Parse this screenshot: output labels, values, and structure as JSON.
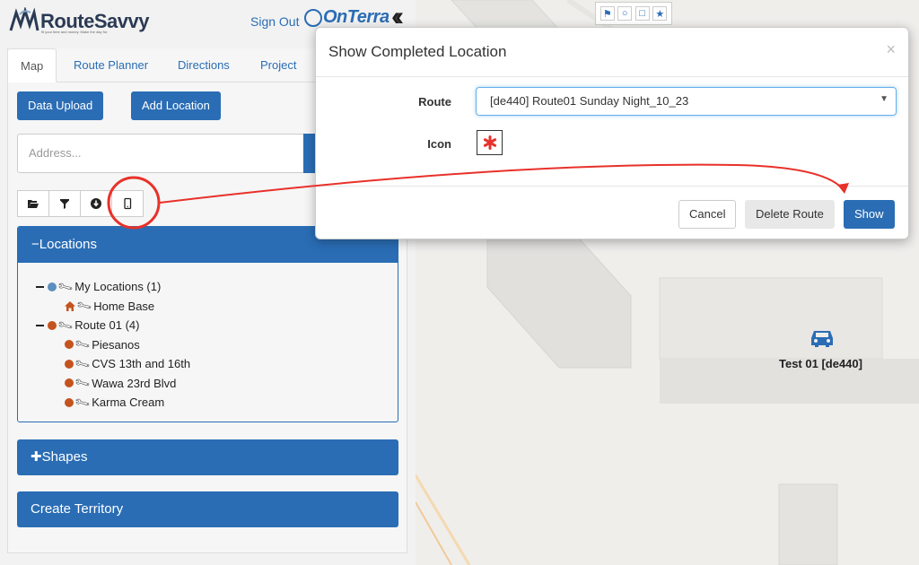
{
  "brand": {
    "logo_name": "RouteSavvy",
    "logo_tagline": "fit your time and money. Make the day for.",
    "partner": "OnTerra"
  },
  "header": {
    "signout_label": "Sign Out",
    "collapse_icon": "double-chevron-left-icon"
  },
  "tabs": [
    {
      "label": "Map",
      "active": true
    },
    {
      "label": "Route Planner"
    },
    {
      "label": "Directions"
    },
    {
      "label": "Project"
    }
  ],
  "actions": {
    "data_upload": "Data Upload",
    "add_location": "Add Location"
  },
  "search": {
    "placeholder": "Address..."
  },
  "toolbar": {
    "icons": [
      "folder-open-icon",
      "filter-icon",
      "download-circle-icon",
      "mobile-icon"
    ]
  },
  "locations": {
    "header": "−Locations",
    "groups": [
      {
        "label": "My Locations (1)",
        "color": "#5b8fbf",
        "items": [
          {
            "label": "Home Base",
            "icon": "home-icon"
          }
        ]
      },
      {
        "label": "Route 01 (4)",
        "color": "#c5531e",
        "items": [
          {
            "label": "Piesanos"
          },
          {
            "label": "CVS 13th and 16th"
          },
          {
            "label": "Wawa 23rd Blvd"
          },
          {
            "label": "Karma Cream"
          }
        ]
      }
    ]
  },
  "shapes_header": "✚Shapes",
  "territory_header": "Create Territory",
  "map": {
    "tools": [
      "flag-icon",
      "circle-icon",
      "square-icon",
      "star-icon"
    ],
    "marker_label": "Test 01 [de440]"
  },
  "modal": {
    "title": "Show Completed Location",
    "close": "×",
    "route_label": "Route",
    "route_value": "[de440] Route01 Sunday Night_10_23",
    "icon_label": "Icon",
    "cancel": "Cancel",
    "delete": "Delete Route",
    "show": "Show"
  },
  "colors": {
    "accent": "#2a6db5",
    "annotation": "#e8312a",
    "route_dot": "#c5531e",
    "my_dot": "#5b8fbf"
  }
}
